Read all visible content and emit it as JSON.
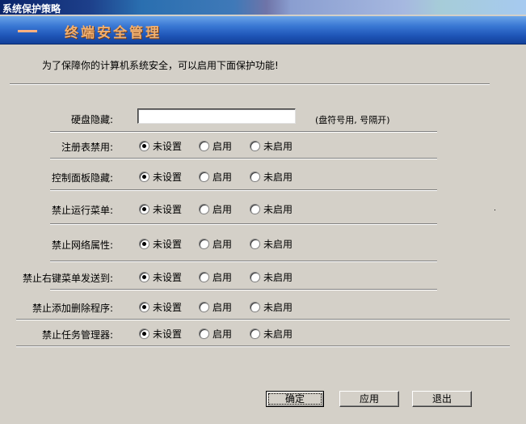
{
  "window": {
    "title": "系统保护策略"
  },
  "banner": {
    "dashes": "——",
    "title": "终端安全管理"
  },
  "intro": "为了保障你的计算机系统安全，可以启用下面保护功能!",
  "disk_hide": {
    "label": "硬盘隐藏:",
    "value": "",
    "hint": "(盘符号用, 号隔开)"
  },
  "radio_labels": [
    "未设置",
    "启用",
    "未启用"
  ],
  "rows": [
    {
      "label": "注册表禁用:",
      "selected": 0
    },
    {
      "label": "控制面板隐藏:",
      "selected": 0
    },
    {
      "label": "禁止运行菜单:",
      "selected": 0
    },
    {
      "label": "禁止网络属性:",
      "selected": 0
    },
    {
      "label": "禁止右键菜单发送到:",
      "selected": 0
    },
    {
      "label": "禁止添加删除程序:",
      "selected": 0
    },
    {
      "label": "禁止任务管理器:",
      "selected": 0
    }
  ],
  "buttons": {
    "ok": "确定",
    "apply": "应用",
    "exit": "退出"
  }
}
